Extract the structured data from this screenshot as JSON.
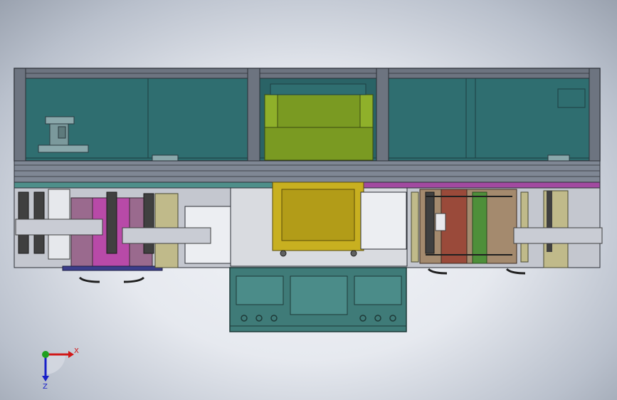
{
  "viewport": {
    "background": "#c8cdd6",
    "model": "machine-assembly-front-view"
  },
  "triad": {
    "x_label": "X",
    "z_label": "Z",
    "colors": {
      "x": "#d01818",
      "z": "#1820c8",
      "origin": "#20a020"
    }
  },
  "palette": {
    "frame": "#5b6270",
    "glass": "#2f6b6e",
    "glass_dark": "#245558",
    "green_block": "#7a9a22",
    "yellow_block": "#c8b020",
    "base_grey": "#c4c7cf",
    "magenta": "#b84aa8",
    "cabinet": "#3f7b78",
    "roller_tan": "#c0ba8a",
    "roller_dark": "#4a4a4a"
  }
}
